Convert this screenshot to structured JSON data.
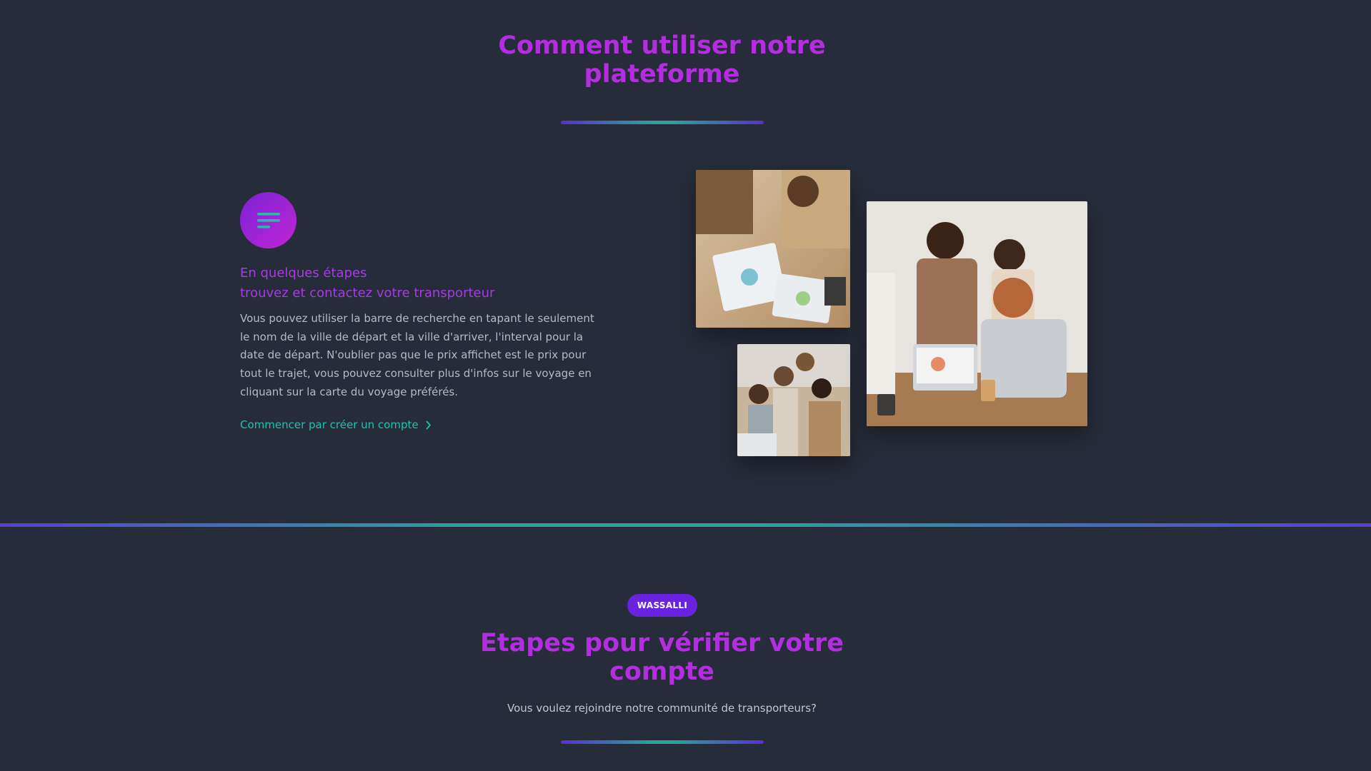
{
  "how_to": {
    "title_line1": "Comment utiliser notre",
    "title_line2": "plateforme",
    "heading_line1": "En quelques étapes",
    "heading_line2": "trouvez et contactez votre transporteur",
    "description": "Vous pouvez utiliser la barre de recherche en tapant le seulement le nom de la ville de départ et la ville d'arriver, l'interval pour la date de départ. N'oublier pas que le prix affichet est le prix pour tout le trajet, vous pouvez consulter plus d'infos sur le voyage en cliquant sur la carte du voyage préférés.",
    "cta_label": "Commencer par créer un compte",
    "menu_icon": "menu-icon",
    "cta_icon": "chevron-right-icon"
  },
  "verify": {
    "tag": "WASSALLI",
    "title_line1": "Etapes pour vérifier votre",
    "title_line2": "compte",
    "subtitle": "Vous voulez rejoindre notre communité de transporteurs?"
  },
  "colors": {
    "background": "#272c3a",
    "accent_purple": "#b52de0",
    "accent_teal": "#1fc3ad",
    "tag_background": "#6a22e0"
  }
}
